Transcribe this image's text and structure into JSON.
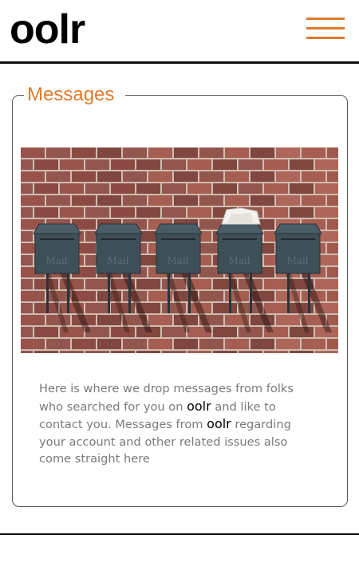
{
  "header": {
    "logo": "oolr",
    "menu_icon": "hamburger-menu-icon"
  },
  "panel": {
    "title": "Messages",
    "image_icon": "mailboxes-photo",
    "description": {
      "part1": "Here is where we drop messages from folks who searched for you on ",
      "brand1": "oolr",
      "part2": " and like to contact you. Messages from ",
      "brand2": "oolr",
      "part3": " regarding your account and other related issues also come straight here"
    },
    "mailbox_labels": [
      "Mail",
      "Mail",
      "Mail",
      "Mail",
      "Mail"
    ]
  },
  "colors": {
    "accent": "#e07a2a",
    "text_muted": "#7a7a7a",
    "rule": "#111111",
    "mailbox": "#3d4f57",
    "brick": "#8a3f36"
  }
}
